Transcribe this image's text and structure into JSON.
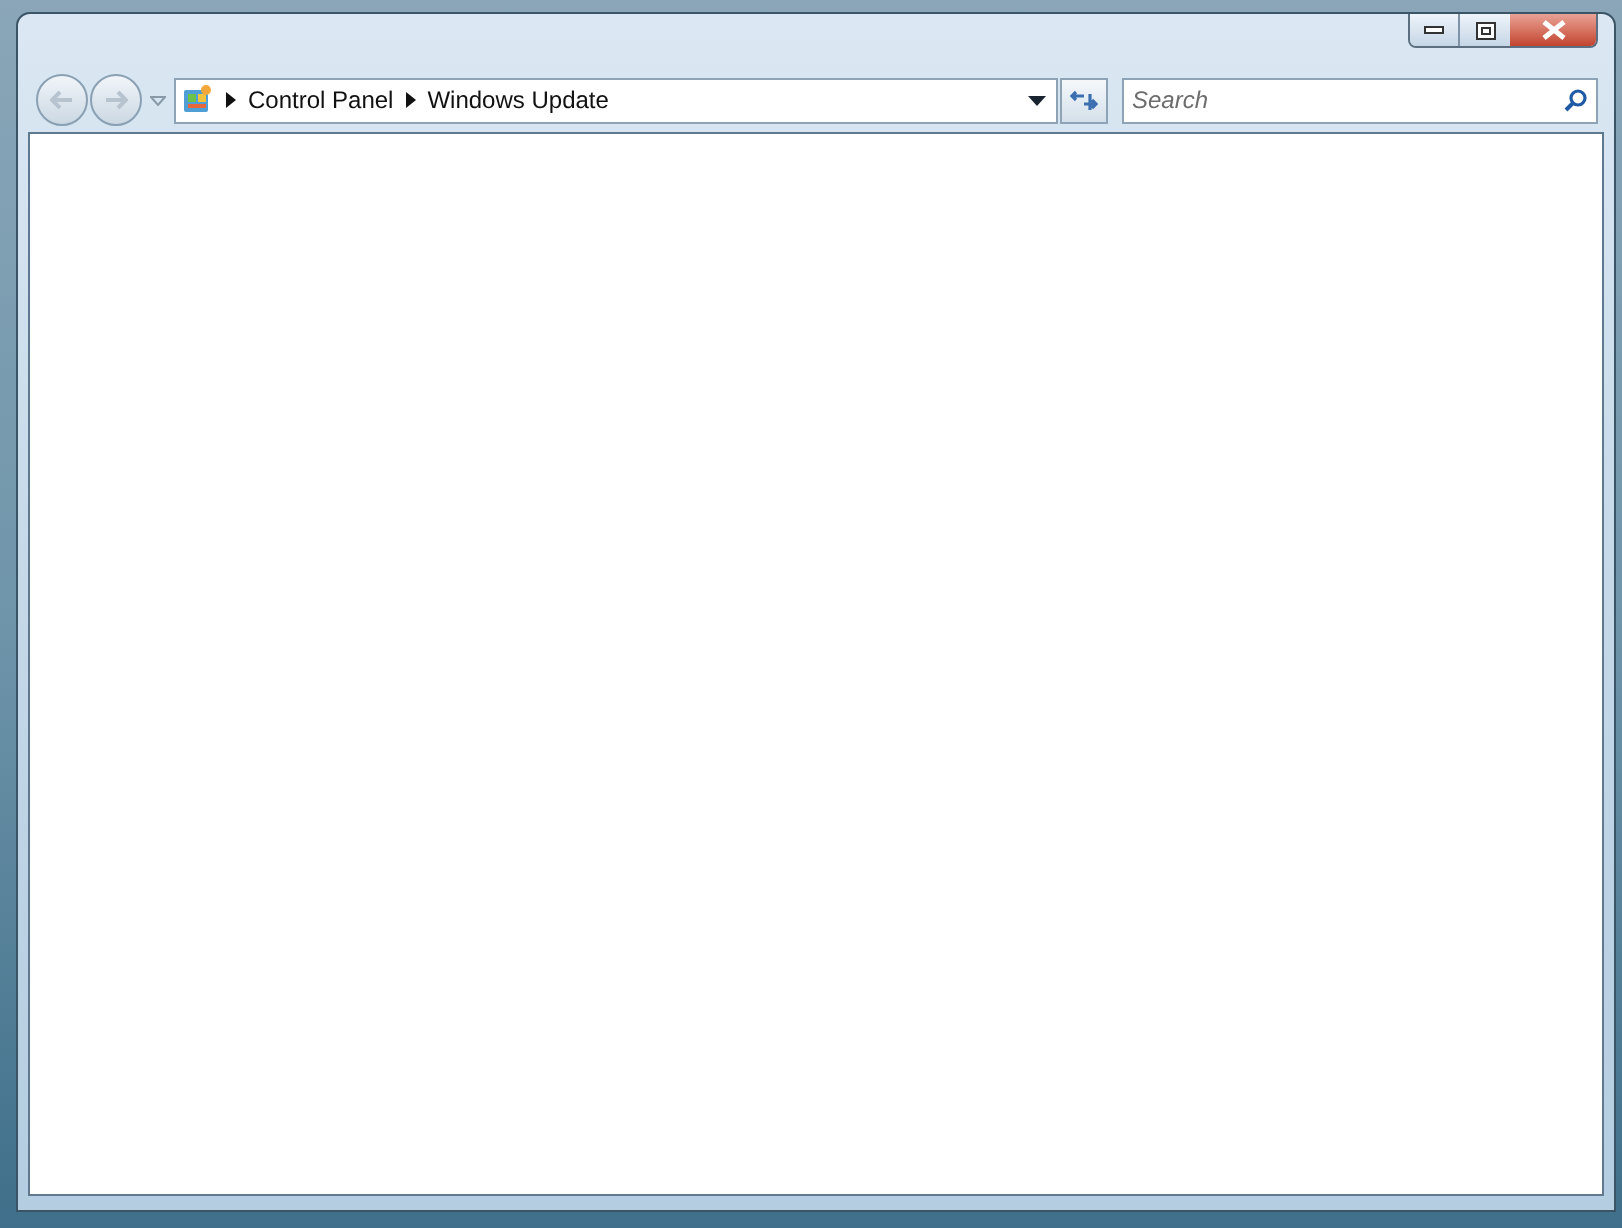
{
  "window": {
    "breadcrumb": [
      "Control Panel",
      "Windows Update"
    ]
  },
  "search": {
    "placeholder": "Search"
  }
}
